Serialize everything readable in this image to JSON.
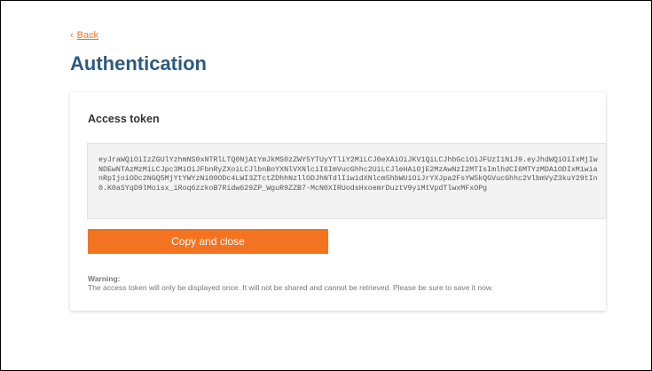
{
  "nav": {
    "back_chevron": "‹",
    "back_label": "Back"
  },
  "page": {
    "title": "Authentication"
  },
  "card": {
    "title": "Access token",
    "token": "eyJraWQiOiIzZGUlYzhmNS0xNTRlLTQ0NjAtYmJkMS0zZWY5YTUyYTliY2MiLCJ0eXAiOiJKV1QiLCJhbGciOiJFUzI1NiJ9.eyJhdWQiOiIxMjIwNDEwNTAzMzMiLCJpc3MiOiJFbnRyZXoiLCJlbnBoYXNlVXNlciI6ImVucGhhc2UiLCJleHAiOjE2MzAwNzI2MTIsImlhdCI6MTYzMDA1ODIxMiwianRpIjoiODc2NGQ5MjYtYWYzNi00ODc4LWI3ZTctZDhhNzllODJhNTdlIiwidXNlcm5hbWUiOiJrYXJpa2FsYW5kQGVucGhhc2VlbmVyZ3kuY29tIn0.K0aSYqD9lMoisx_iRoq6zzkoB7Ridw629ZP_WguR9ZZB7-McN0XIRUodsHxoemrDuztV9yiMtVpdTlwxMFxOPg",
    "copy_button_label": "Copy and close",
    "warning_label": "Warning:",
    "warning_text": "The access token will only be displayed once. It will not be shared and cannot be retrieved. Please be sure to save it now."
  },
  "colors": {
    "accent": "#f47321",
    "title": "#2d5a7f"
  }
}
